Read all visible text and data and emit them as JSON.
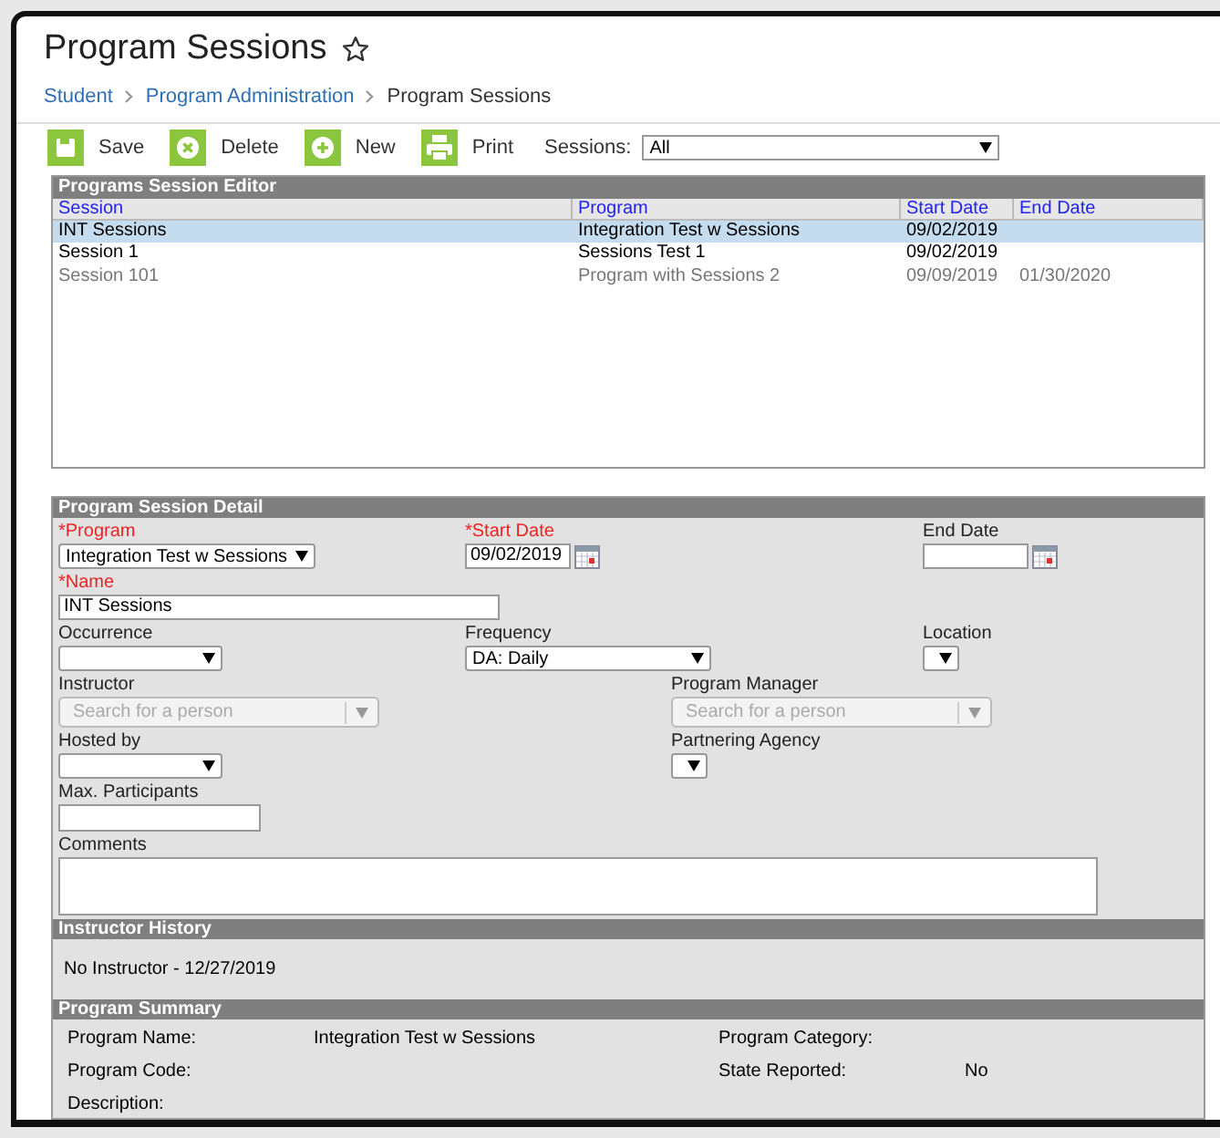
{
  "page": {
    "title": "Program Sessions",
    "favorite": false
  },
  "breadcrumb": [
    {
      "label": "Student",
      "link": true
    },
    {
      "label": "Program Administration",
      "link": true
    },
    {
      "label": "Program Sessions",
      "link": false
    }
  ],
  "toolbar": {
    "buttons": [
      {
        "kind": "save",
        "label": "Save"
      },
      {
        "kind": "delete",
        "label": "Delete"
      },
      {
        "kind": "new",
        "label": "New"
      },
      {
        "kind": "print",
        "label": "Print"
      }
    ],
    "filter": {
      "label": "Sessions:",
      "value": "All"
    }
  },
  "editor": {
    "title": "Programs Session Editor",
    "columns": [
      "Session",
      "Program",
      "Start Date",
      "End Date"
    ],
    "rows": [
      {
        "cells": [
          "INT Sessions",
          "Integration Test w Sessions",
          "09/02/2019",
          ""
        ],
        "selected": true,
        "inactive": false
      },
      {
        "cells": [
          "Session 1",
          "Sessions Test 1",
          "09/02/2019",
          ""
        ],
        "selected": false,
        "inactive": false
      },
      {
        "cells": [
          "Session 101",
          "Program with Sessions 2",
          "09/09/2019",
          "01/30/2020"
        ],
        "selected": false,
        "inactive": true
      }
    ]
  },
  "detail": {
    "title": "Program Session Detail",
    "rows": [
      {
        "kind": "three",
        "fields": [
          {
            "kind": "select",
            "label": "*Program",
            "required": true,
            "value": "Integration Test w Sessions"
          },
          {
            "kind": "date",
            "label": "*Start Date",
            "required": true,
            "value": "09/02/2019"
          },
          {
            "kind": "date",
            "label": "End Date",
            "required": false
          }
        ]
      },
      {
        "kind": "three",
        "fields": [
          {
            "kind": "text",
            "label": "*Name",
            "required": true,
            "value": "INT Sessions"
          }
        ]
      },
      {
        "kind": "three",
        "fields": [
          {
            "kind": "select",
            "label": "Occurrence",
            "required": false
          },
          {
            "kind": "wideselect",
            "label": "Frequency",
            "required": false,
            "value": "DA: Daily"
          },
          {
            "kind": "tinyselect",
            "label": "Location",
            "required": false
          }
        ]
      },
      {
        "kind": "two",
        "fields": [
          {
            "kind": "person",
            "label": "Instructor",
            "required": false,
            "placeholder": "Search for a person"
          },
          {
            "kind": "person",
            "label": "Program Manager",
            "required": false,
            "placeholder": "Search for a person"
          }
        ]
      },
      {
        "kind": "two",
        "fields": [
          {
            "kind": "select",
            "label": "Hosted by",
            "required": false
          },
          {
            "kind": "tinyselect",
            "label": "Partnering Agency",
            "required": false
          }
        ]
      },
      {
        "kind": "two",
        "fields": [
          {
            "kind": "short",
            "label": "Max. Participants",
            "required": false
          }
        ]
      },
      {
        "kind": "two",
        "fields": [
          {
            "kind": "textarea",
            "label": "Comments",
            "required": false
          }
        ]
      }
    ]
  },
  "instructor_history": {
    "title": "Instructor History",
    "entries": [
      "No Instructor - 12/27/2019"
    ]
  },
  "summary": {
    "title": "Program Summary",
    "items": [
      {
        "label": "Program Name:",
        "value": "Integration Test w Sessions"
      },
      {
        "label": "Program Category:"
      },
      {
        "label": "Program Code:"
      },
      {
        "label": "State Reported:",
        "value": "No"
      },
      {
        "label": "Description:"
      }
    ]
  }
}
